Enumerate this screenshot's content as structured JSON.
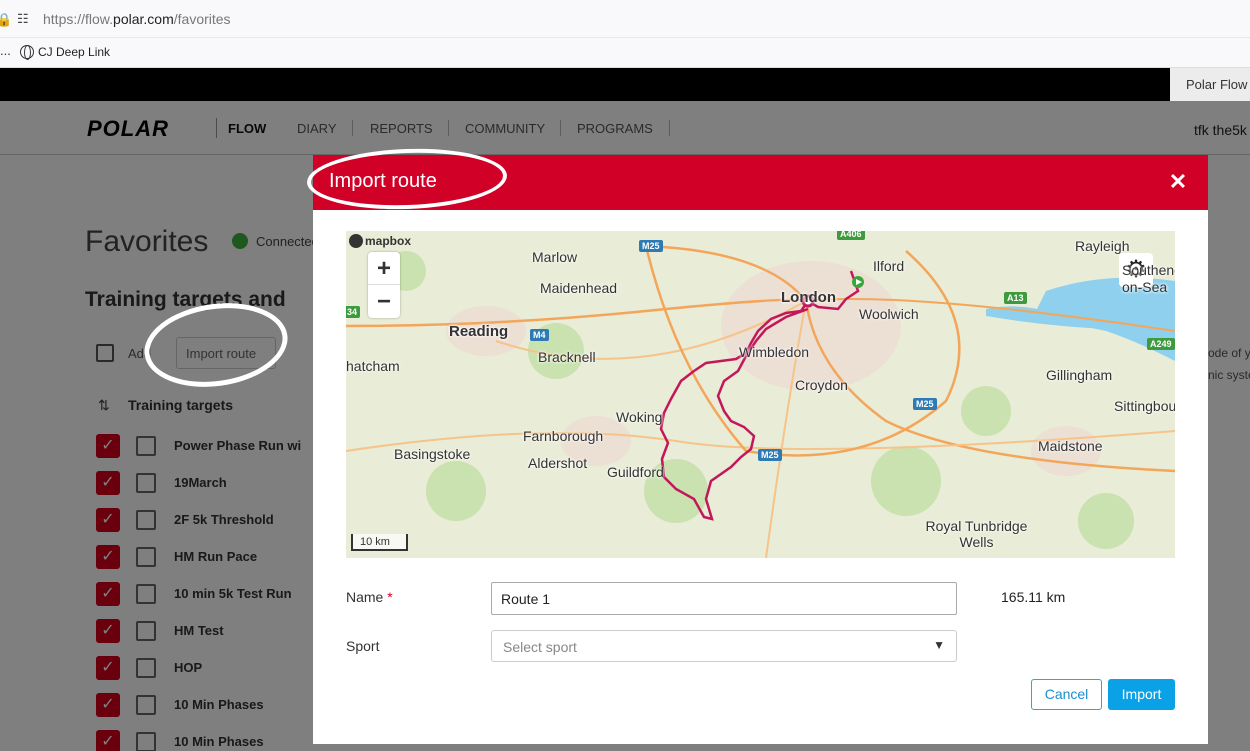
{
  "browser": {
    "url_prefix": "https://flow.",
    "url_host": "polar.com",
    "url_path": "/favorites",
    "bookmarks_overflow": "...",
    "bookmark_label": "CJ Deep Link",
    "tab_title": "Polar Flow"
  },
  "nav": {
    "logo": "POLAR",
    "product": "FLOW",
    "items": [
      "DIARY",
      "REPORTS",
      "COMMUNITY",
      "PROGRAMS"
    ],
    "user": "tfk the5k"
  },
  "page": {
    "title": "Favorites",
    "status": "Connected",
    "section_title": "Training targets and",
    "add_label": "Add",
    "import_label": "Import route",
    "list_header": "Training targets",
    "targets": [
      "Power Phase Run wi",
      "19March",
      "2F 5k Threshold",
      "HM Run Pace",
      "10 min 5k Test Run",
      "HM Test",
      "HOP",
      "10 Min Phases",
      "10 Min Phases"
    ],
    "right_snippets": [
      "ode of y",
      "nic syste"
    ]
  },
  "modal": {
    "title": "Import route",
    "close_icon": "close-icon",
    "map": {
      "attribution": "mapbox",
      "scale_label": "10 km",
      "places": [
        "Marlow",
        "Maidenhead",
        "Reading",
        "Bracknell",
        "hatcham",
        "Basingstoke",
        "Farnborough",
        "Aldershot",
        "Woking",
        "Guildford",
        "Wimbledon",
        "London",
        "Croydon",
        "Ilford",
        "Woolwich",
        "Rayleigh",
        "Southend-on-Sea",
        "Gillingham",
        "Sittingbou",
        "Maidstone",
        "Royal Tunbridge Wells"
      ],
      "roads": [
        "M25",
        "M4",
        "A13",
        "A249",
        "M25",
        "M25",
        "A406",
        "34"
      ]
    },
    "name_label": "Name",
    "required_mark": "*",
    "name_value": "Route 1",
    "distance": "165.11 km",
    "sport_label": "Sport",
    "sport_placeholder": "Select sport",
    "cancel_label": "Cancel",
    "import_label": "Import"
  },
  "colors": {
    "brand_red": "#d10027",
    "route": "#c2185b",
    "primary_button": "#0aa1e6"
  }
}
